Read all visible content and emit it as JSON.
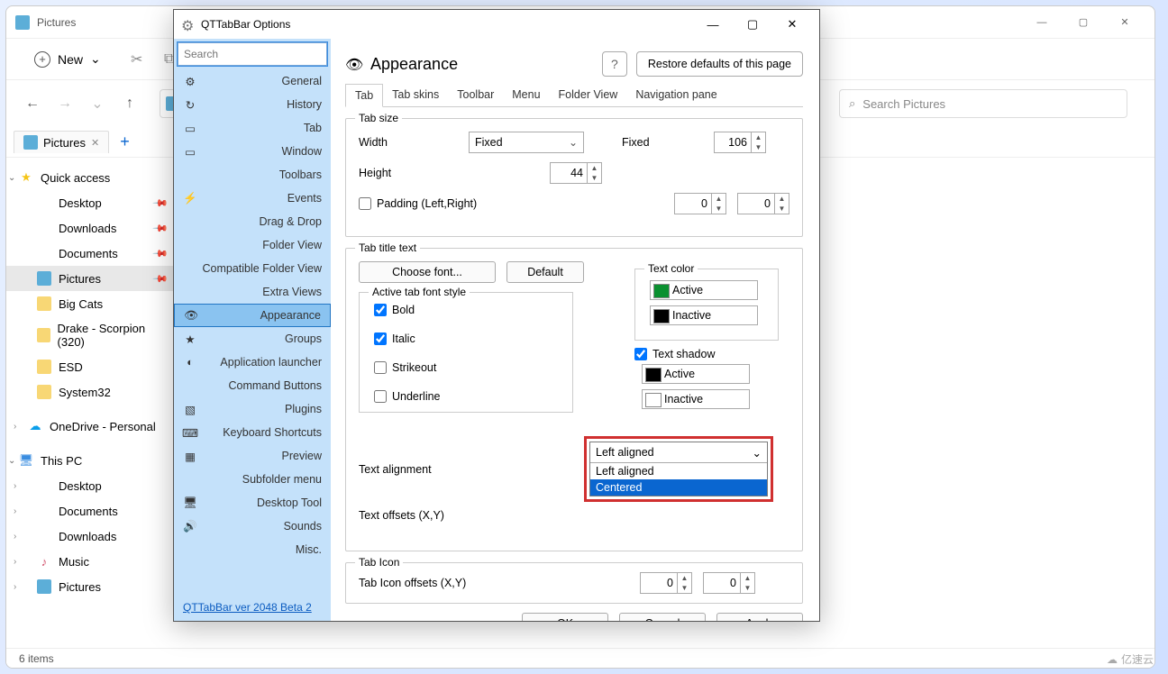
{
  "explorer": {
    "title": "Pictures",
    "new_btn": "New",
    "search_placeholder": "Search Pictures",
    "tab_label": "Pictures",
    "status": "6 items"
  },
  "sidebar": {
    "quick": {
      "label": "Quick access"
    },
    "items": [
      {
        "icon": "desk",
        "label": "Desktop",
        "pin": true
      },
      {
        "icon": "down",
        "label": "Downloads",
        "pin": true
      },
      {
        "icon": "doc",
        "label": "Documents",
        "pin": true
      },
      {
        "icon": "pic",
        "label": "Pictures",
        "pin": true,
        "sel": true
      },
      {
        "icon": "folder",
        "label": "Big Cats"
      },
      {
        "icon": "folder",
        "label": "Drake - Scorpion (320)"
      },
      {
        "icon": "folder",
        "label": "ESD"
      },
      {
        "icon": "folder",
        "label": "System32"
      }
    ],
    "onedrive": "OneDrive - Personal",
    "thispc": {
      "label": "This PC",
      "children": [
        "Desktop",
        "Documents",
        "Downloads",
        "Music",
        "Pictures"
      ]
    }
  },
  "options": {
    "title": "QTTabBar Options",
    "search_placeholder": "Search",
    "categories": [
      "General",
      "History",
      "Tab",
      "Window",
      "Toolbars",
      "Events",
      "Drag & Drop",
      "Folder View",
      "Compatible Folder View",
      "Extra Views",
      "Appearance",
      "Groups",
      "Application launcher",
      "Command Buttons",
      "Plugins",
      "Keyboard Shortcuts",
      "Preview",
      "Subfolder menu",
      "Desktop Tool",
      "Sounds",
      "Misc."
    ],
    "selected": "Appearance",
    "version": "QTTabBar ver 2048 Beta 2",
    "page_title": "Appearance",
    "help": "?",
    "restore": "Restore defaults of this page",
    "subtabs": [
      "Tab",
      "Tab skins",
      "Toolbar",
      "Menu",
      "Folder View",
      "Navigation pane"
    ],
    "active_subtab": "Tab",
    "tabsize": {
      "legend": "Tab size",
      "width": "Width",
      "width_mode": "Fixed",
      "fixed_label": "Fixed",
      "fixed_val": "106",
      "height": "Height",
      "height_val": "44",
      "padding": "Padding (Left,Right)",
      "pad_l": "0",
      "pad_r": "0"
    },
    "titletext": {
      "legend": "Tab title text",
      "choose_font": "Choose font...",
      "default": "Default",
      "fontstyle_legend": "Active tab font style",
      "bold": "Bold",
      "italic": "Italic",
      "strike": "Strikeout",
      "under": "Underline",
      "textcolor_legend": "Text color",
      "active": "Active",
      "inactive": "Inactive",
      "shadow": "Text shadow",
      "align_label": "Text alignment",
      "align_selected": "Left aligned",
      "align_options": [
        "Left aligned",
        "Centered"
      ],
      "offsets_label": "Text offsets (X,Y)"
    },
    "tabicon": {
      "legend": "Tab Icon",
      "offsets": "Tab Icon offsets (X,Y)",
      "x": "0",
      "y": "0"
    },
    "buttons": {
      "ok": "OK",
      "cancel": "Cancel",
      "apply": "Apply"
    }
  },
  "watermark": "亿速云"
}
